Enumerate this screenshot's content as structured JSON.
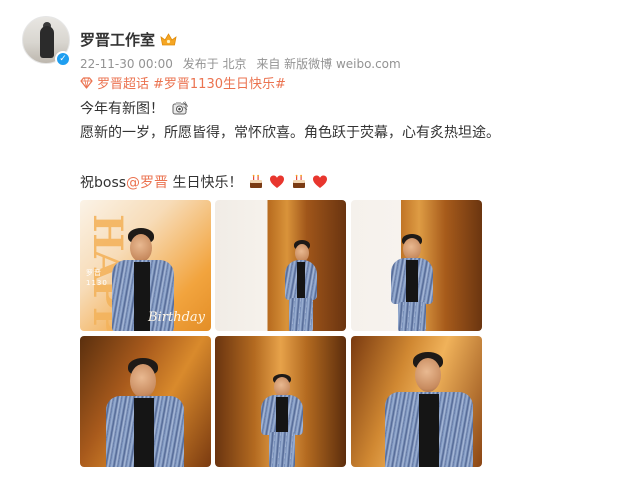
{
  "post": {
    "author": "罗晋工作室",
    "meta": {
      "time": "22-11-30 00:00",
      "location": "发布于 北京",
      "source": "来自 新版微博 weibo.com"
    },
    "topics": {
      "super": "罗晋超话",
      "tag": "#罗晋1130生日快乐#"
    },
    "lines": {
      "line1": "今年有新图！",
      "line2": "愿新的一岁，所愿皆得，常怀欣喜。角色跃于荧幕，心有炙热坦途。",
      "line3_prefix": "祝boss",
      "mention": "@罗晋",
      "line3_suffix": " 生日快乐！"
    },
    "photo1": {
      "happy": "HAPPY",
      "birthday": "Birthday",
      "number": "罗晋\n1130"
    },
    "icons": {
      "crown": "crown-badge-icon",
      "verify": "verified-check-icon",
      "gem": "super-topic-gem-icon",
      "camera": "camera-emoji-icon",
      "cake": "cake-emoji-icon",
      "heart": "red-heart-emoji-icon"
    },
    "colors": {
      "accent": "#eb7350",
      "meta": "#939393",
      "verify": "#1e9ef0"
    }
  }
}
